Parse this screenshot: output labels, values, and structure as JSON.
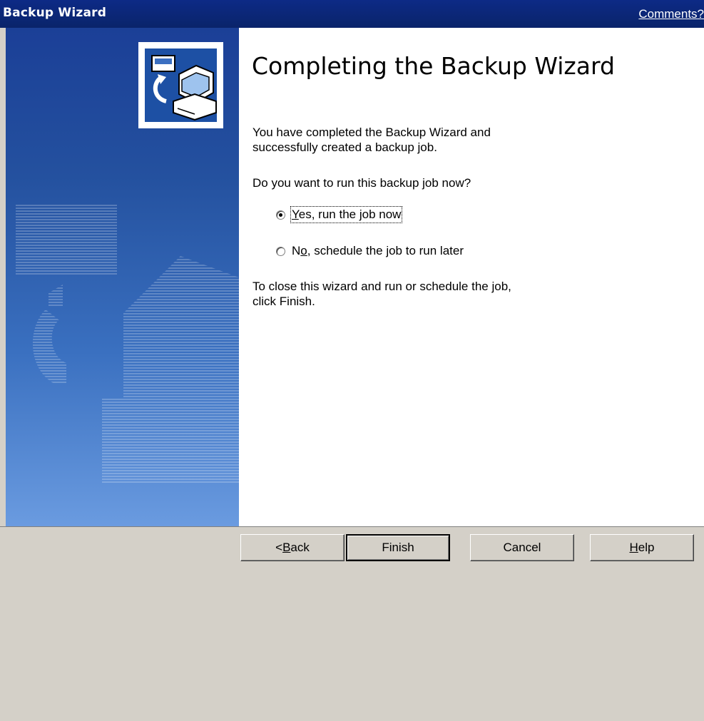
{
  "window": {
    "title": "Backup Wizard",
    "comments_link": "Comments?"
  },
  "side_panel": {
    "icon": "backup-computer-icon",
    "watermark_icon": "backup-computer-watermark-icon"
  },
  "main": {
    "heading": "Completing the Backup Wizard",
    "intro_line1": "You have completed the Backup Wizard and",
    "intro_line2": "successfully created a backup job.",
    "question": "Do you want to run this backup job now?",
    "options": [
      {
        "pre": "",
        "key": "Y",
        "post": "es, run the job now",
        "selected": true
      },
      {
        "pre": "N",
        "key": "o",
        "post": ", schedule the job to run later",
        "selected": false
      }
    ],
    "closing_line1": "To close this wizard and run or schedule the job,",
    "closing_line2": "click Finish."
  },
  "footer": {
    "back": {
      "pre": "< ",
      "key": "B",
      "post": "ack"
    },
    "finish": "Finish",
    "cancel": "Cancel",
    "help": {
      "key": "H",
      "post": "elp"
    }
  }
}
